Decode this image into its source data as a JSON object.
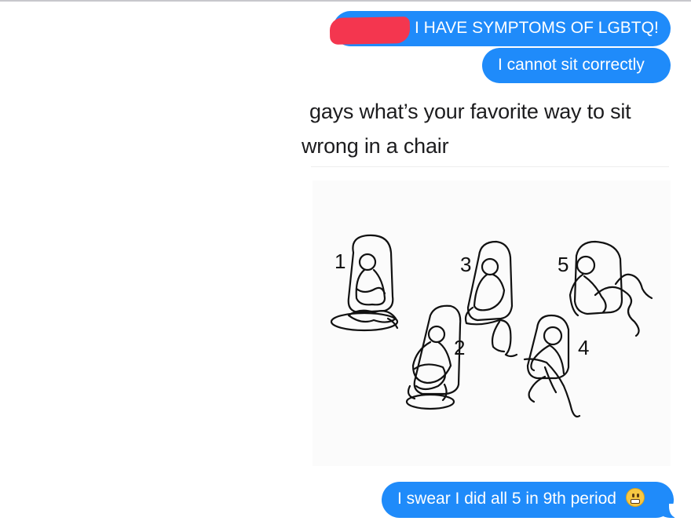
{
  "messages": [
    {
      "text": "I HAVE SYMPTOMS OF LGBTQ!",
      "has_redaction": true,
      "redaction_color": "#f4364f"
    },
    {
      "text": "I cannot sit correctly"
    },
    {
      "text": "I swear I did all 5 in 9th period",
      "emoji": "grimacing-face-icon"
    }
  ],
  "shared_image": {
    "tweet_line_1": "gays what’s your favorite way to sit",
    "tweet_line_2": "wrong in a chair",
    "figure_labels": [
      "1",
      "2",
      "3",
      "4",
      "5"
    ]
  },
  "colors": {
    "bubble": "#1f8bfa",
    "bubble_text": "#ffffff",
    "background": "#ffffff"
  }
}
